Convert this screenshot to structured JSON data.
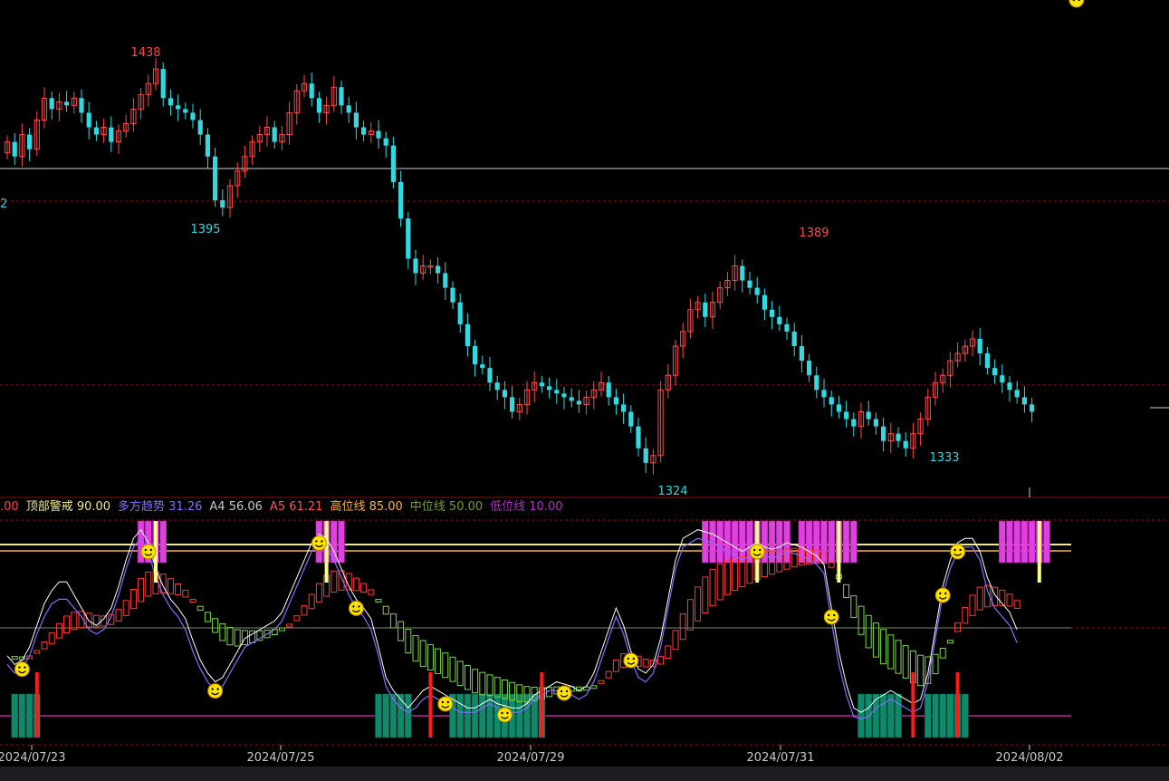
{
  "price_labels": {
    "high_1": "1438",
    "low_1": "1395",
    "high_2": "1389",
    "low_2": "1324",
    "low_3": "1333",
    "edge_left": "2"
  },
  "legend": {
    "items": [
      {
        "label": ".00",
        "value": "",
        "color": "#ff4040"
      },
      {
        "label": "顶部警戒",
        "value": "90.00",
        "color": "#f0e68c"
      },
      {
        "label": "多方趋势",
        "value": "31.26",
        "color": "#8a6bff"
      },
      {
        "label": "A4",
        "value": "56.06",
        "color": "#c8c8c8"
      },
      {
        "label": "A5",
        "value": "61.21",
        "color": "#ff5050"
      },
      {
        "label": "高位线",
        "value": "85.00",
        "color": "#ffb040"
      },
      {
        "label": "中位线",
        "value": "50.00",
        "color": "#7a9a30"
      },
      {
        "label": "低位线",
        "value": "10.00",
        "color": "#b030c0"
      }
    ]
  },
  "colors": {
    "up": "#ff4a4a",
    "down": "#33d9e0",
    "magenta": "#e040e0",
    "teal": "#0e8a6a",
    "red_signal": "#ff1a1a",
    "yellow_bar": "#ffff88",
    "green_ladder": "#7ad84a",
    "red_ladder": "#ff3a3a",
    "white_line": "#ffffff",
    "purple_line": "#8a6bff",
    "orange_line": "#ffb040",
    "gold_line": "#f0e68c",
    "mid_line": "#7a8a70",
    "low_line": "#c020a0",
    "grid": "#8a1010",
    "emoji": "#ffe400"
  },
  "chart_data": {
    "type": "candlestick",
    "x_labels": [
      "2024/07/23",
      "2024/07/25",
      "2024/07/29",
      "2024/07/31",
      "2024/08/02"
    ],
    "y_levels": {
      "high": 1438,
      "low": 1324,
      "recent_high": 1389,
      "recent_low": 1333,
      "early_low": 1395
    },
    "closes": [
      1416,
      1412,
      1418,
      1414,
      1422,
      1428,
      1425,
      1427,
      1426,
      1428,
      1424,
      1420,
      1418,
      1420,
      1416,
      1419,
      1421,
      1425,
      1429,
      1432,
      1436,
      1428,
      1426,
      1425,
      1424,
      1422,
      1418,
      1412,
      1400,
      1398,
      1404,
      1408,
      1412,
      1416,
      1418,
      1420,
      1416,
      1418,
      1424,
      1430,
      1432,
      1428,
      1424,
      1426,
      1431,
      1426,
      1424,
      1420,
      1418,
      1419,
      1417,
      1415,
      1405,
      1395,
      1384,
      1380,
      1382,
      1382,
      1380,
      1376,
      1372,
      1366,
      1360,
      1355,
      1354,
      1350,
      1348,
      1346,
      1342,
      1344,
      1348,
      1350,
      1349,
      1348,
      1347,
      1346,
      1345,
      1344,
      1346,
      1348,
      1350,
      1346,
      1344,
      1342,
      1338,
      1332,
      1328,
      1330,
      1348,
      1352,
      1360,
      1364,
      1370,
      1372,
      1368,
      1372,
      1376,
      1378,
      1382,
      1378,
      1376,
      1374,
      1370,
      1368,
      1366,
      1364,
      1360,
      1356,
      1352,
      1348,
      1346,
      1344,
      1342,
      1340,
      1338,
      1342,
      1340,
      1338,
      1334,
      1336,
      1334,
      1332,
      1336,
      1340,
      1346,
      1350,
      1352,
      1356,
      1358,
      1360,
      1362,
      1358,
      1354,
      1352,
      1350,
      1348,
      1346,
      1344,
      1342
    ],
    "oscillator": {
      "top_warning": 90.0,
      "bull_trend": 31.26,
      "A4": 56.06,
      "A5": 61.21,
      "high_line": 85.0,
      "mid_line": 50.0,
      "low_line": 10.0,
      "white_line": [
        38,
        34,
        36,
        42,
        52,
        62,
        68,
        72,
        72,
        66,
        60,
        54,
        52,
        55,
        60,
        70,
        82,
        92,
        96,
        90,
        78,
        70,
        64,
        60,
        55,
        45,
        36,
        30,
        26,
        28,
        34,
        40,
        46,
        48,
        50,
        52,
        54,
        58,
        66,
        74,
        82,
        90,
        94,
        92,
        86,
        78,
        70,
        64,
        60,
        55,
        42,
        28,
        22,
        18,
        14,
        18,
        22,
        24,
        22,
        20,
        18,
        16,
        14,
        14,
        16,
        18,
        16,
        15,
        14,
        14,
        16,
        20,
        22,
        24,
        26,
        25,
        24,
        22,
        24,
        30,
        40,
        50,
        60,
        52,
        40,
        32,
        30,
        34,
        46,
        64,
        82,
        92,
        94,
        96,
        95,
        94,
        92,
        90,
        88,
        86,
        88,
        90,
        88,
        87,
        88,
        90,
        89,
        88,
        86,
        84,
        80,
        60,
        40,
        25,
        14,
        12,
        14,
        18,
        20,
        22,
        20,
        18,
        16,
        18,
        30,
        50,
        70,
        82,
        90,
        92,
        92,
        86,
        74,
        66,
        62,
        58,
        50
      ],
      "purple_line": [
        34,
        30,
        32,
        38,
        48,
        56,
        62,
        64,
        64,
        60,
        56,
        50,
        48,
        50,
        56,
        66,
        78,
        88,
        92,
        86,
        74,
        66,
        60,
        56,
        50,
        40,
        32,
        26,
        22,
        24,
        30,
        36,
        42,
        44,
        46,
        48,
        50,
        54,
        62,
        70,
        78,
        86,
        90,
        88,
        82,
        74,
        66,
        60,
        56,
        50,
        38,
        24,
        18,
        14,
        12,
        14,
        18,
        20,
        18,
        16,
        14,
        12,
        12,
        12,
        14,
        16,
        14,
        13,
        12,
        12,
        14,
        18,
        20,
        22,
        22,
        21,
        20,
        18,
        20,
        26,
        36,
        46,
        56,
        48,
        36,
        28,
        26,
        30,
        42,
        60,
        78,
        88,
        90,
        92,
        91,
        90,
        88,
        86,
        84,
        82,
        84,
        86,
        84,
        83,
        84,
        86,
        85,
        84,
        82,
        80,
        76,
        54,
        34,
        20,
        10,
        9,
        10,
        14,
        16,
        18,
        16,
        14,
        12,
        14,
        26,
        46,
        66,
        78,
        86,
        88,
        88,
        82,
        68,
        60,
        56,
        52,
        44
      ],
      "smile_positions": [
        2,
        19,
        28,
        42,
        47,
        59,
        67,
        75,
        84,
        101,
        111,
        126,
        128,
        144
      ],
      "magenta_bars": [
        [
          18,
          21
        ],
        [
          42,
          45
        ],
        [
          94,
          105
        ],
        [
          107,
          114
        ],
        [
          134,
          140
        ]
      ],
      "teal_bars": [
        [
          1,
          4
        ],
        [
          50,
          54
        ],
        [
          60,
          72
        ],
        [
          115,
          120
        ],
        [
          124,
          129
        ]
      ],
      "red_signals": [
        4,
        57,
        72,
        122,
        128
      ],
      "yellow_bars": [
        20,
        43,
        101,
        112,
        139
      ]
    }
  }
}
